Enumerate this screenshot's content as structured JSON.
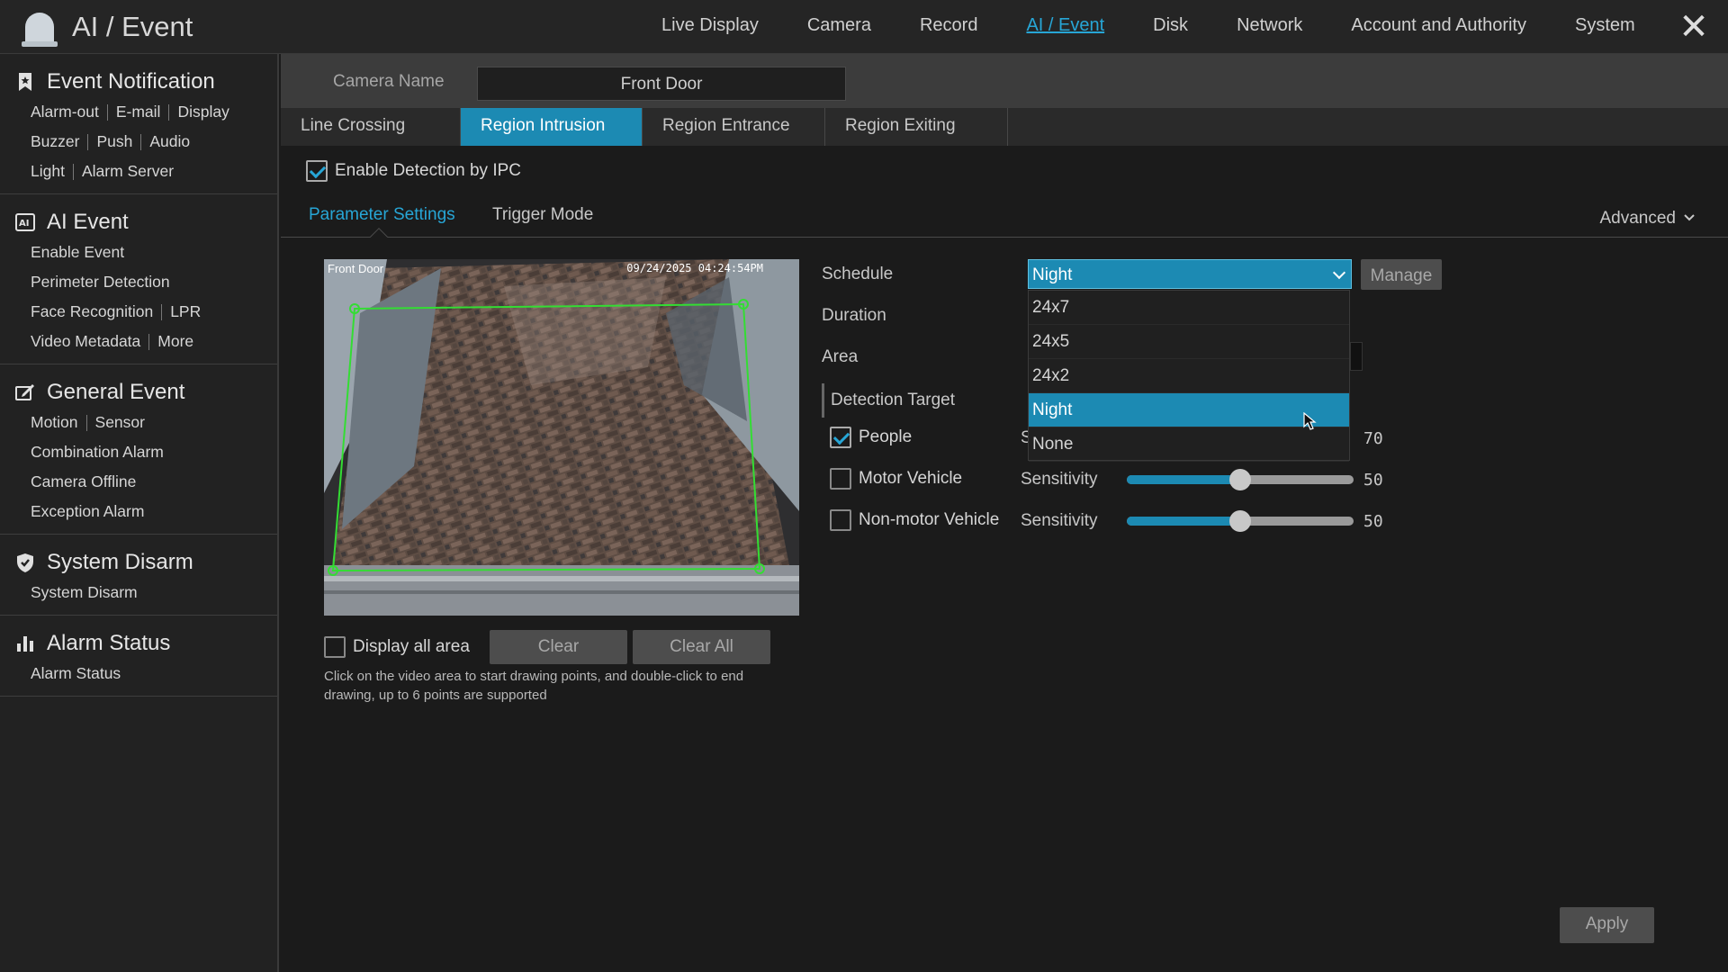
{
  "app": {
    "title": "AI / Event"
  },
  "topnav": {
    "items": [
      "Live Display",
      "Camera",
      "Record",
      "AI / Event",
      "Disk",
      "Network",
      "Account and Authority",
      "System"
    ],
    "active": "AI / Event"
  },
  "sidebar": {
    "event_notification": {
      "title": "Event Notification",
      "rows": [
        [
          "Alarm-out",
          "E-mail",
          "Display"
        ],
        [
          "Buzzer",
          "Push",
          "Audio"
        ],
        [
          "Light",
          "Alarm Server"
        ]
      ]
    },
    "ai_event": {
      "title": "AI Event",
      "rows": [
        [
          "Enable Event"
        ],
        [
          "Perimeter Detection"
        ],
        [
          "Face Recognition",
          "LPR"
        ],
        [
          "Video Metadata",
          "More"
        ]
      ]
    },
    "general_event": {
      "title": "General Event",
      "rows": [
        [
          "Motion",
          "Sensor"
        ],
        [
          "Combination Alarm"
        ],
        [
          "Camera Offline"
        ],
        [
          "Exception Alarm"
        ]
      ]
    },
    "system_disarm": {
      "title": "System Disarm",
      "rows": [
        [
          "System Disarm"
        ]
      ]
    },
    "alarm_status": {
      "title": "Alarm Status",
      "rows": [
        [
          "Alarm Status"
        ]
      ]
    }
  },
  "camera": {
    "label": "Camera Name",
    "value": "Front Door"
  },
  "tabs": [
    "Line Crossing",
    "Region Intrusion",
    "Region Entrance",
    "Region Exiting"
  ],
  "active_tab": "Region Intrusion",
  "enable_detection": {
    "label": "Enable Detection by IPC",
    "checked": true
  },
  "subtabs": {
    "parameter": "Parameter Settings",
    "trigger": "Trigger Mode",
    "advanced": "Advanced"
  },
  "video": {
    "name": "Front Door",
    "timestamp": "09/24/2025 04:24:54PM"
  },
  "display_all_area": {
    "label": "Display all area",
    "checked": false
  },
  "buttons": {
    "clear": "Clear",
    "clear_all": "Clear All",
    "manage": "Manage",
    "apply": "Apply"
  },
  "hint": "Click on the video area to start drawing points, and double-click to end drawing, up to 6 points are supported",
  "form": {
    "schedule_label": "Schedule",
    "schedule_value": "Night",
    "schedule_options": [
      "24x7",
      "24x5",
      "24x2",
      "Night",
      "None"
    ],
    "duration_label": "Duration",
    "area_label": "Area",
    "detection_target_label": "Detection Target",
    "sensitivity_label": "Sensitivity",
    "targets": [
      {
        "name": "People",
        "checked": true,
        "sensitivity": 70,
        "sens_prefix": "S"
      },
      {
        "name": "Motor Vehicle",
        "checked": false,
        "sensitivity": 50
      },
      {
        "name": "Non-motor Vehicle",
        "checked": false,
        "sensitivity": 50
      }
    ]
  },
  "colors": {
    "accent": "#1c8ab3",
    "link": "#27a6d6",
    "polygon": "#33dd33"
  }
}
